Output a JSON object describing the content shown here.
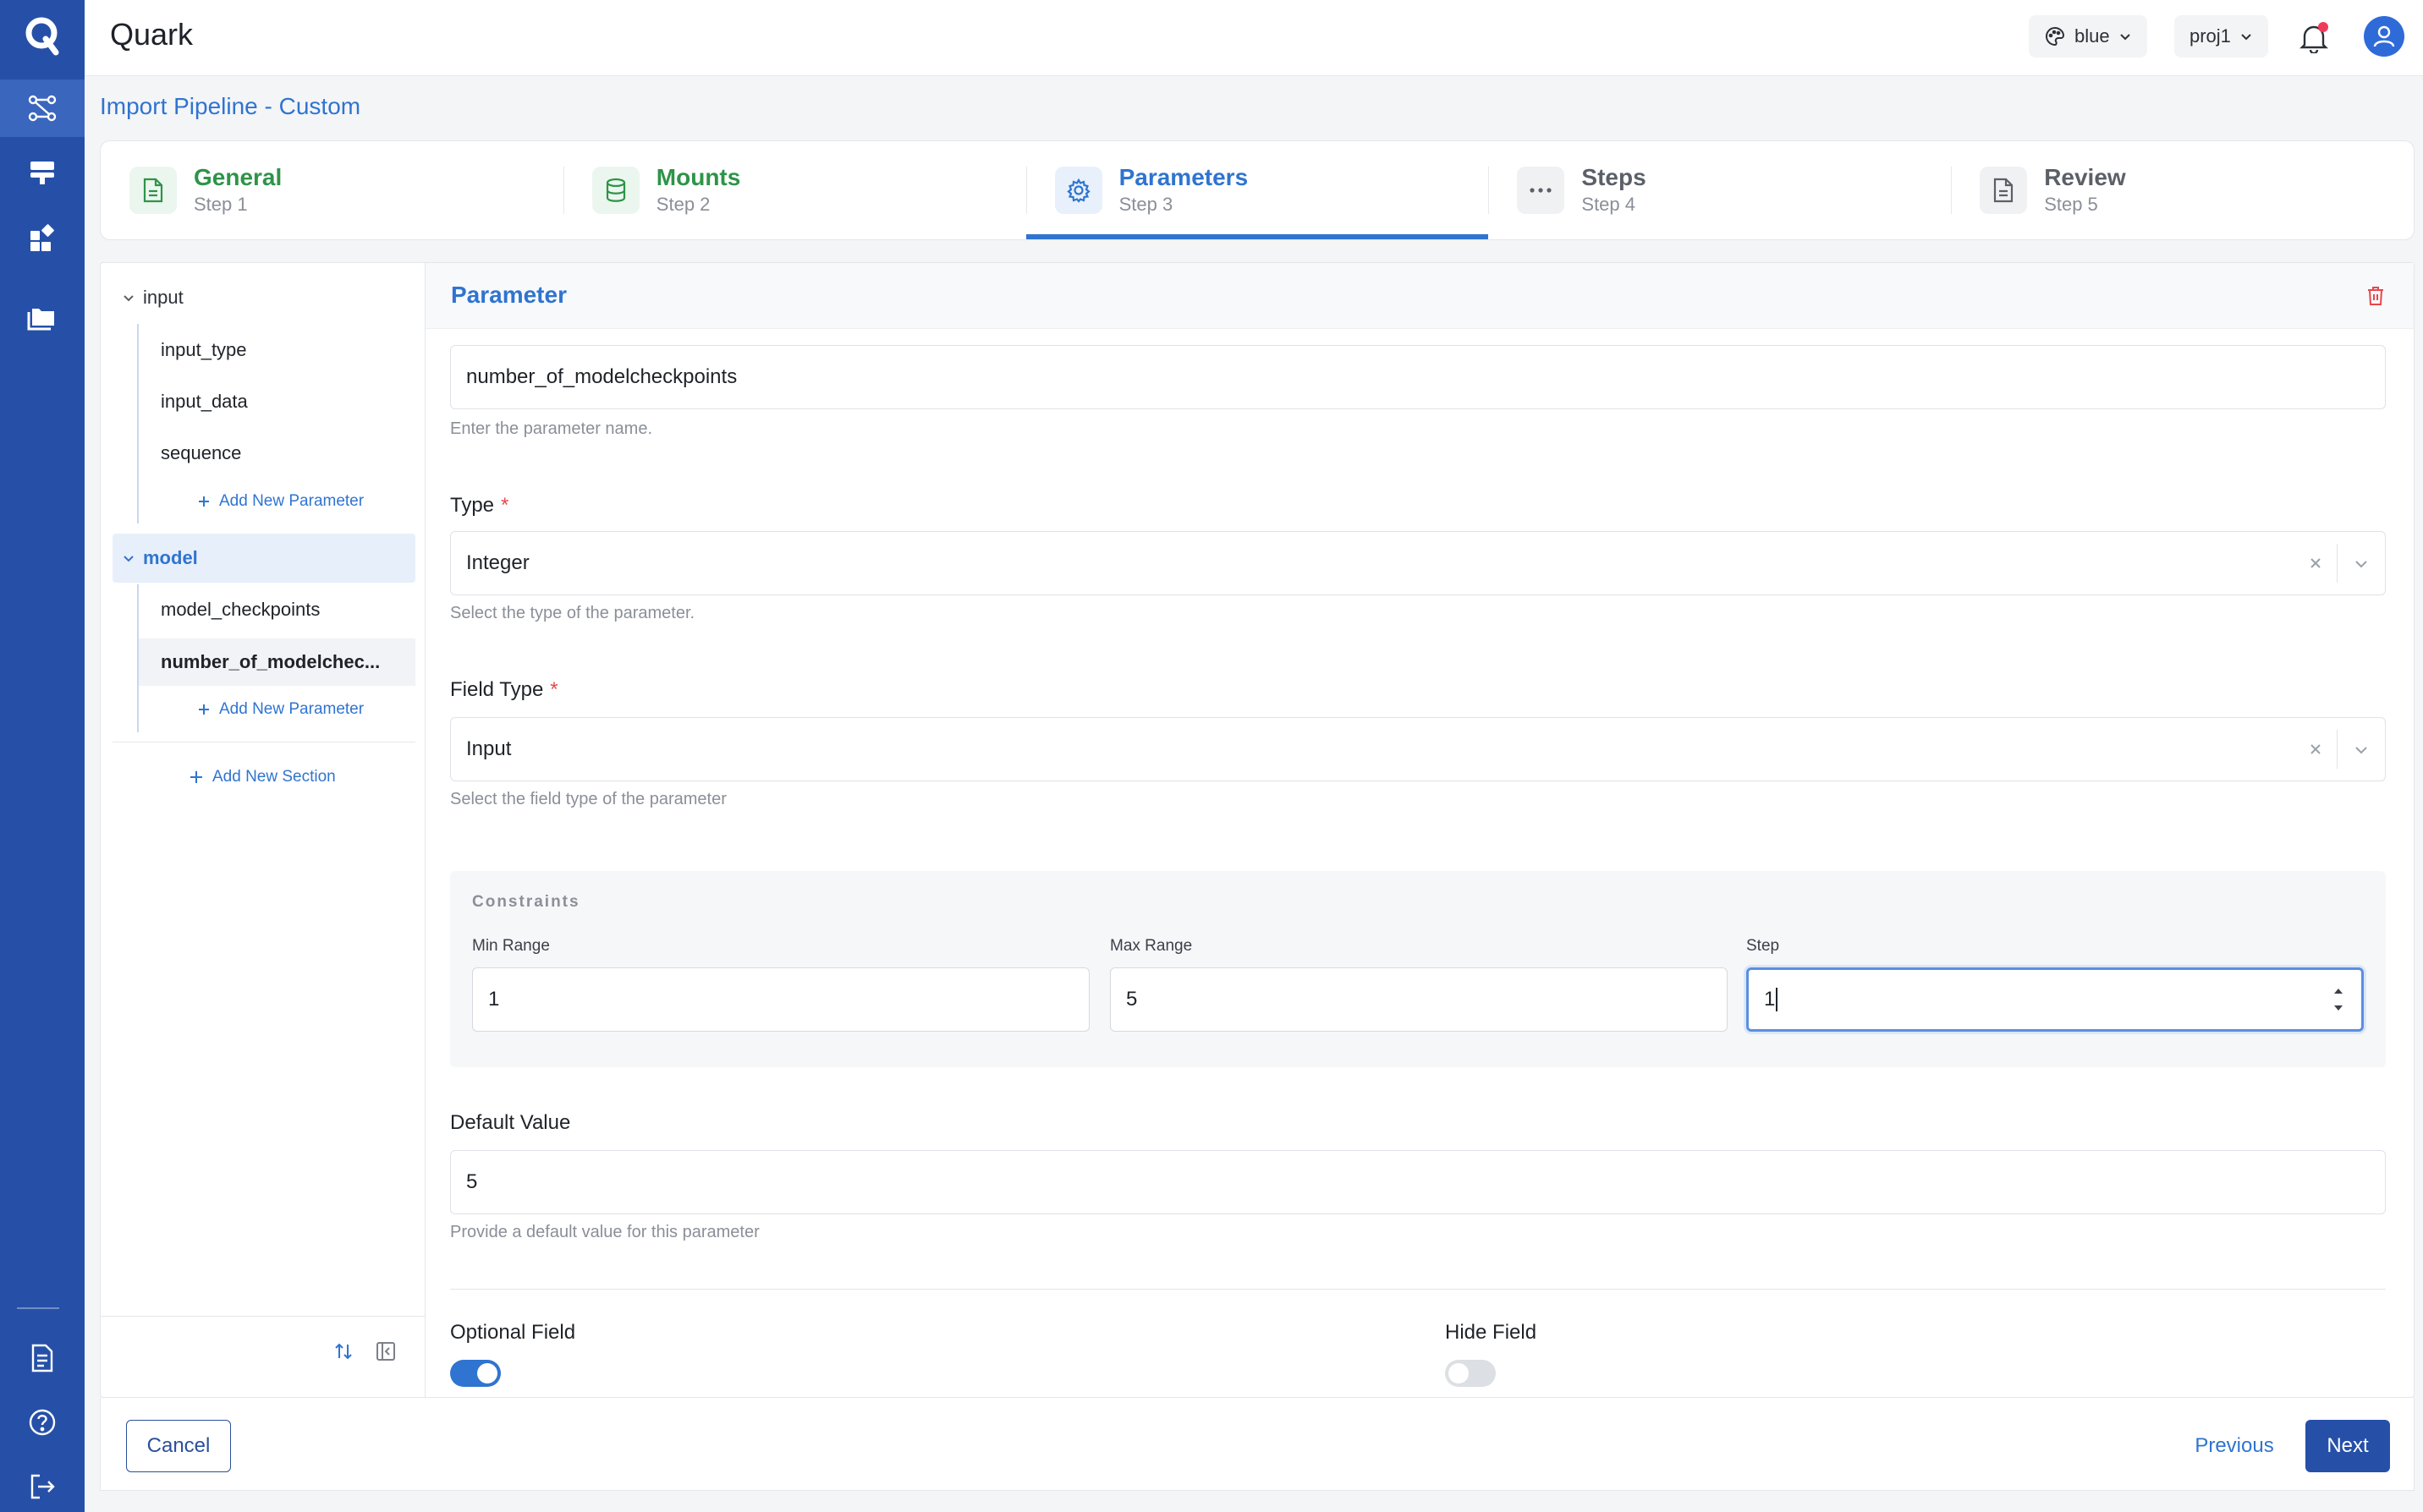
{
  "app": {
    "title": "Quark",
    "theme_select": "blue",
    "project_select": "proj1"
  },
  "page": {
    "title": "Import Pipeline - Custom"
  },
  "steps": [
    {
      "title": "General",
      "sub": "Step 1",
      "state": "done",
      "icon": "document-icon"
    },
    {
      "title": "Mounts",
      "sub": "Step 2",
      "state": "done",
      "icon": "database-icon"
    },
    {
      "title": "Parameters",
      "sub": "Step 3",
      "state": "current",
      "icon": "gear-icon"
    },
    {
      "title": "Steps",
      "sub": "Step 4",
      "state": "todo",
      "icon": "ellipsis-icon"
    },
    {
      "title": "Review",
      "sub": "Step 5",
      "state": "todo",
      "icon": "document-icon"
    }
  ],
  "tree": {
    "sections": [
      {
        "name": "input",
        "items": [
          "input_type",
          "input_data",
          "sequence"
        ],
        "add_label": "Add New Parameter"
      },
      {
        "name": "model",
        "items": [
          "model_checkpoints",
          "number_of_modelchec..."
        ],
        "add_label": "Add New Parameter"
      }
    ],
    "add_section_label": "Add New Section"
  },
  "form": {
    "header": "Parameter",
    "name": {
      "value": "number_of_modelcheckpoints",
      "hint": "Enter the parameter name."
    },
    "type": {
      "label": "Type",
      "required_mark": "*",
      "value": "Integer",
      "hint": "Select the type of the parameter."
    },
    "field_type": {
      "label": "Field Type",
      "required_mark": "*",
      "value": "Input",
      "hint": "Select the field type of the parameter"
    },
    "constraints": {
      "title": "Constraints",
      "min_label": "Min Range",
      "min_value": "1",
      "max_label": "Max Range",
      "max_value": "5",
      "step_label": "Step",
      "step_value": "1"
    },
    "default_value": {
      "label": "Default Value",
      "value": "5",
      "hint": "Provide a default value for this parameter"
    },
    "optional_field": {
      "label": "Optional Field",
      "on": true
    },
    "hide_field": {
      "label": "Hide Field",
      "on": false
    }
  },
  "footer": {
    "cancel": "Cancel",
    "previous": "Previous",
    "next": "Next"
  },
  "colors": {
    "rail": "#2650a8",
    "accent": "#2f74d0",
    "done": "#2e9448",
    "danger": "#e5484d"
  }
}
